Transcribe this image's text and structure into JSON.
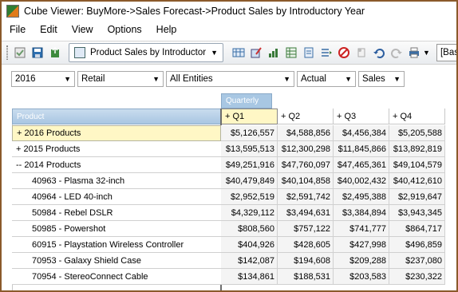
{
  "window": {
    "title": "Cube Viewer: BuyMore->Sales Forecast->Product Sales by Introductory Year"
  },
  "menu": [
    "File",
    "Edit",
    "View",
    "Options",
    "Help"
  ],
  "toolbar": {
    "tab_label": "Product Sales by Introductor",
    "base_label": "[Bas"
  },
  "filters": [
    {
      "value": "2016"
    },
    {
      "value": "Retail"
    },
    {
      "value": "All Entities"
    },
    {
      "value": "Actual"
    },
    {
      "value": "Sales"
    }
  ],
  "grid": {
    "column_group_label": "Quarterly",
    "row_header_label": "Product",
    "columns": [
      "+ Q1",
      "+ Q2",
      "+ Q3",
      "+ Q4"
    ],
    "rows": [
      {
        "label": "+ 2016 Products",
        "values": [
          "$5,126,557",
          "$4,588,856",
          "$4,456,384",
          "$5,205,588"
        ]
      },
      {
        "label": "+ 2015 Products",
        "values": [
          "$13,595,513",
          "$12,300,298",
          "$11,845,866",
          "$13,892,819"
        ]
      },
      {
        "label": "-- 2014 Products",
        "values": [
          "$49,251,916",
          "$47,760,097",
          "$47,465,361",
          "$49,104,579"
        ]
      },
      {
        "label": "40963 - Plasma 32-inch",
        "values": [
          "$40,479,849",
          "$40,104,858",
          "$40,002,432",
          "$40,412,610"
        ]
      },
      {
        "label": "40964 - LED 40-inch",
        "values": [
          "$2,952,519",
          "$2,591,742",
          "$2,495,388",
          "$2,919,647"
        ]
      },
      {
        "label": "50984 - Rebel DSLR",
        "values": [
          "$4,329,112",
          "$3,494,631",
          "$3,384,894",
          "$3,943,345"
        ]
      },
      {
        "label": "50985 - Powershot",
        "values": [
          "$808,560",
          "$757,122",
          "$741,777",
          "$864,717"
        ]
      },
      {
        "label": "60915 - Playstation Wireless Controller",
        "values": [
          "$404,926",
          "$428,605",
          "$427,998",
          "$496,859"
        ]
      },
      {
        "label": "70953 - Galaxy Shield Case",
        "values": [
          "$142,087",
          "$194,608",
          "$209,288",
          "$237,080"
        ]
      },
      {
        "label": "70954 - StereoConnect Cable",
        "values": [
          "$134,861",
          "$188,531",
          "$203,583",
          "$230,322"
        ]
      }
    ]
  }
}
